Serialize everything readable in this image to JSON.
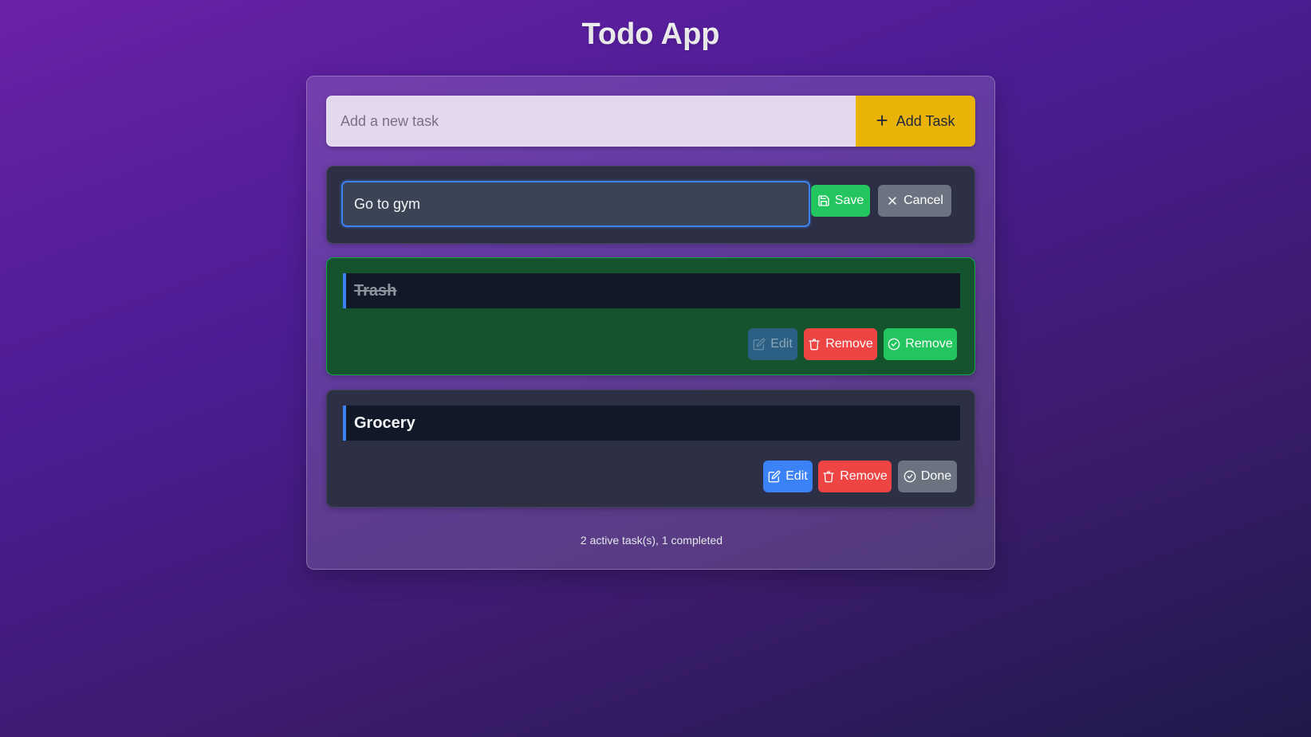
{
  "app": {
    "title": "Todo App"
  },
  "add": {
    "placeholder": "Add a new task",
    "button_label": "Add Task",
    "button_icon": "plus-icon"
  },
  "editing_task": {
    "value": "Go to gym",
    "save_label": "Save",
    "cancel_label": "Cancel"
  },
  "tasks": [
    {
      "text": "Trash",
      "completed": true,
      "edit_label": "Edit",
      "remove_label": "Remove",
      "toggle_label": "Remove"
    },
    {
      "text": "Grocery",
      "completed": false,
      "edit_label": "Edit",
      "remove_label": "Remove",
      "toggle_label": "Done"
    }
  ],
  "footer": {
    "status": "2 active task(s), 1 completed"
  },
  "colors": {
    "accent_yellow": "#eab308",
    "save_green": "#22c55e",
    "remove_red": "#ef4444",
    "edit_blue": "#3b82f6",
    "neutral_gray": "#6b7280",
    "completed_bg": "#14532d"
  }
}
